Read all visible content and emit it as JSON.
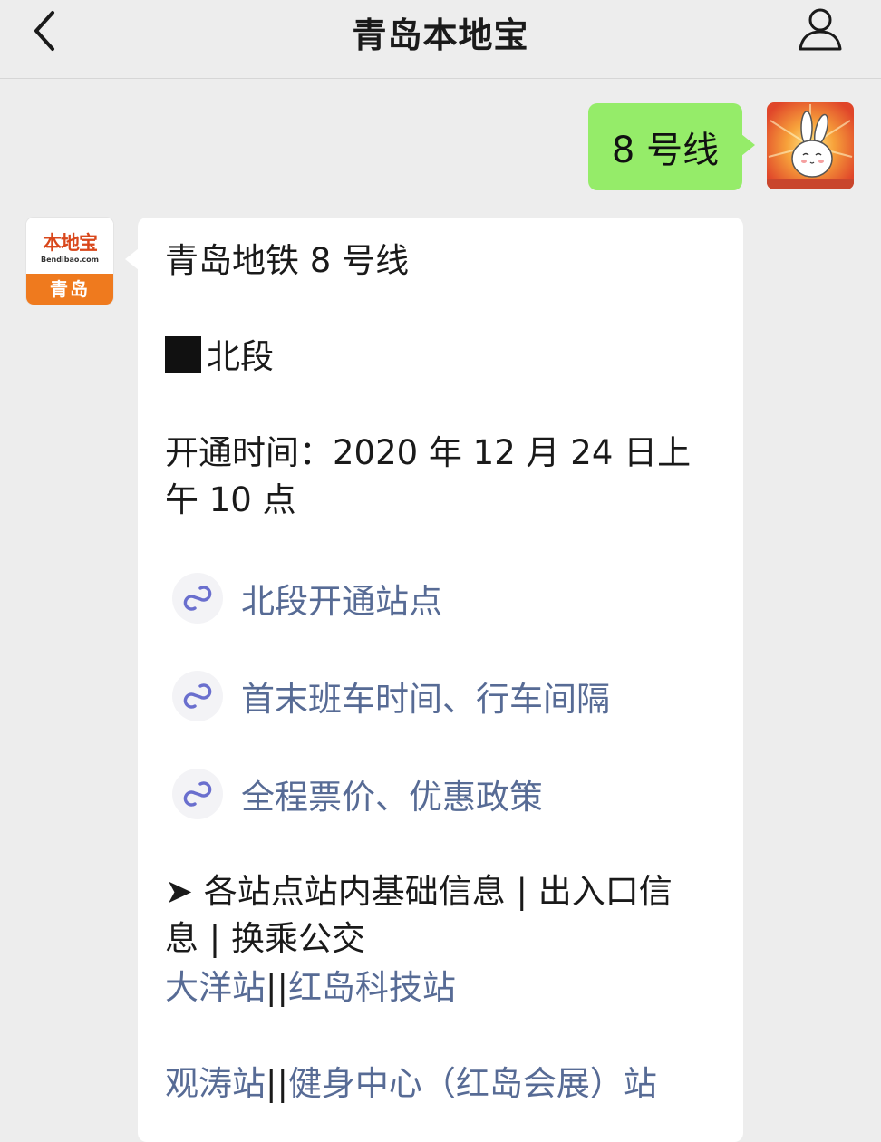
{
  "header": {
    "title": "青岛本地宝"
  },
  "chat": {
    "outgoing": {
      "text": "8 号线"
    },
    "incoming_avatar": {
      "brand": "本地宝",
      "url": "Bendibao.com",
      "city": "青岛"
    },
    "incoming": {
      "title": "青岛地铁 8 号线",
      "section": "北段",
      "opening_line1": "开通时间：2020 年 12 月 24 日上",
      "opening_line2": "午 10 点",
      "mini_links": [
        "北段开通站点",
        "首末班车时间、行车间隔",
        "全程票价、优惠政策"
      ],
      "info_line1": "➤ 各站点站内基础信息 | 出入口信",
      "info_line2": "息 | 换乘公交",
      "stations_row1": [
        "大洋站",
        "红岛科技站"
      ],
      "stations_row2": [
        "观涛站",
        "健身中心（红岛会展）站"
      ],
      "separator": "||"
    }
  },
  "colors": {
    "background": "#ededed",
    "bubble_me": "#95ec69",
    "bubble_other": "#ffffff",
    "link": "#576b95",
    "brand_orange": "#ef7a1e"
  }
}
